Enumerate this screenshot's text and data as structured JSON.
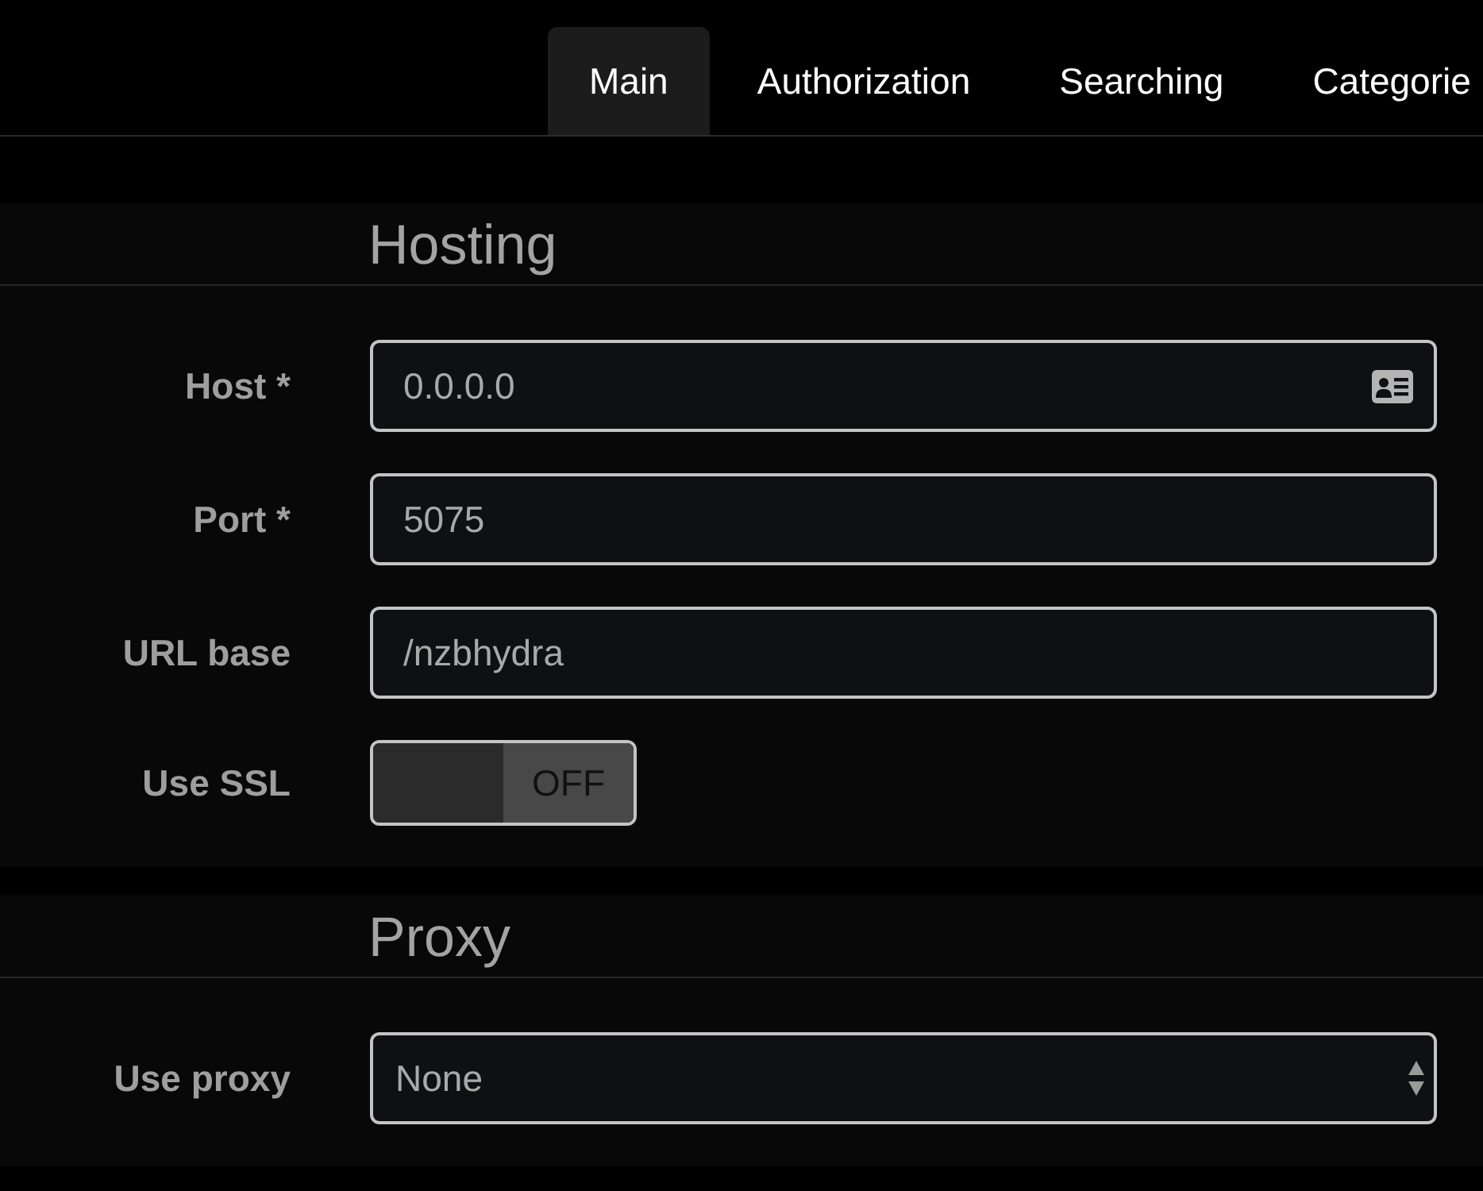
{
  "tabs": [
    {
      "label": "Main",
      "selected": true
    },
    {
      "label": "Authorization",
      "selected": false
    },
    {
      "label": "Searching",
      "selected": false
    },
    {
      "label": "Categorie",
      "selected": false
    }
  ],
  "sections": [
    {
      "title": "Hosting",
      "fields": [
        {
          "kind": "text",
          "label": "Host *",
          "value": "0.0.0.0",
          "icon": true
        },
        {
          "kind": "text",
          "label": "Port *",
          "value": "5075"
        },
        {
          "kind": "text",
          "label": "URL base",
          "value": "/nzbhydra"
        },
        {
          "kind": "toggle",
          "label": "Use SSL",
          "on": false,
          "state_text": "OFF"
        }
      ]
    },
    {
      "title": "Proxy",
      "fields": [
        {
          "kind": "select",
          "label": "Use proxy",
          "value": "None"
        }
      ]
    }
  ]
}
